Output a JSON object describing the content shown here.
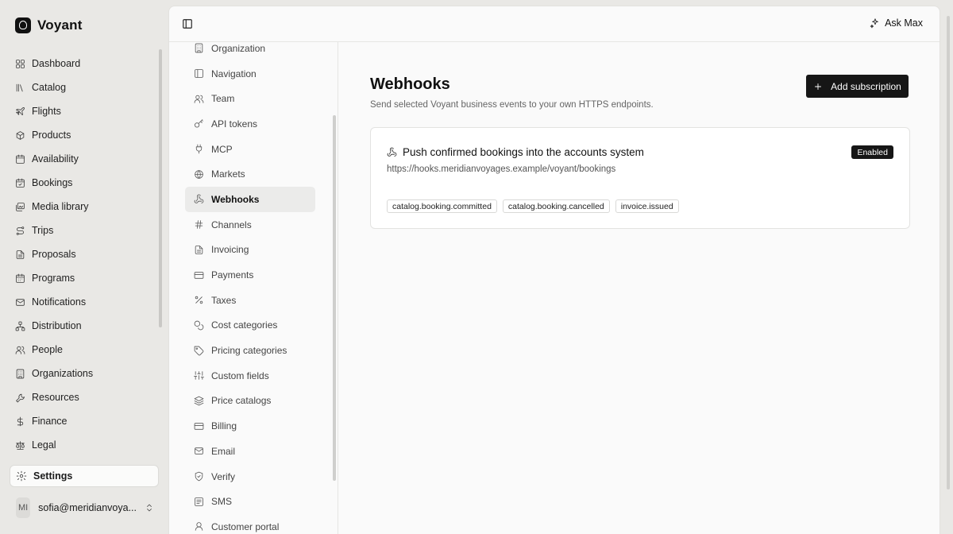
{
  "brand": {
    "name": "Voyant",
    "logo_icon": "voyant-logo"
  },
  "app_nav": [
    {
      "label": "Dashboard",
      "icon": "grid-icon"
    },
    {
      "label": "Catalog",
      "icon": "library-icon"
    },
    {
      "label": "Flights",
      "icon": "plane-icon"
    },
    {
      "label": "Products",
      "icon": "package-icon"
    },
    {
      "label": "Availability",
      "icon": "calendar-icon"
    },
    {
      "label": "Bookings",
      "icon": "calendar-check-icon"
    },
    {
      "label": "Media library",
      "icon": "images-icon"
    },
    {
      "label": "Trips",
      "icon": "route-icon"
    },
    {
      "label": "Proposals",
      "icon": "file-text-icon"
    },
    {
      "label": "Programs",
      "icon": "calendar-days-icon"
    },
    {
      "label": "Notifications",
      "icon": "mail-icon"
    },
    {
      "label": "Distribution",
      "icon": "network-icon"
    },
    {
      "label": "People",
      "icon": "users-icon"
    },
    {
      "label": "Organizations",
      "icon": "building-icon"
    },
    {
      "label": "Resources",
      "icon": "wrench-icon"
    },
    {
      "label": "Finance",
      "icon": "dollar-icon"
    },
    {
      "label": "Legal",
      "icon": "scale-icon"
    }
  ],
  "settings_item": {
    "label": "Settings",
    "icon": "gear-icon"
  },
  "user": {
    "initials": "MI",
    "email": "sofia@meridianvoya..."
  },
  "topbar": {
    "ask_label": "Ask Max"
  },
  "settings_nav": [
    {
      "label": "Organization",
      "icon": "building-icon"
    },
    {
      "label": "Navigation",
      "icon": "panel-left-icon"
    },
    {
      "label": "Team",
      "icon": "users-icon"
    },
    {
      "label": "API tokens",
      "icon": "key-icon"
    },
    {
      "label": "MCP",
      "icon": "plug-icon"
    },
    {
      "label": "Markets",
      "icon": "globe-icon"
    },
    {
      "label": "Webhooks",
      "icon": "webhook-icon",
      "active": true
    },
    {
      "label": "Channels",
      "icon": "hash-icon"
    },
    {
      "label": "Invoicing",
      "icon": "file-text-icon"
    },
    {
      "label": "Payments",
      "icon": "credit-card-icon"
    },
    {
      "label": "Taxes",
      "icon": "percent-icon"
    },
    {
      "label": "Cost categories",
      "icon": "coins-icon"
    },
    {
      "label": "Pricing categories",
      "icon": "tag-icon"
    },
    {
      "label": "Custom fields",
      "icon": "sliders-icon"
    },
    {
      "label": "Price catalogs",
      "icon": "layers-icon"
    },
    {
      "label": "Billing",
      "icon": "credit-card-icon"
    },
    {
      "label": "Email",
      "icon": "mail-icon"
    },
    {
      "label": "Verify",
      "icon": "shield-check-icon"
    },
    {
      "label": "SMS",
      "icon": "message-square-icon"
    },
    {
      "label": "Customer portal",
      "icon": "user-icon"
    }
  ],
  "page": {
    "title": "Webhooks",
    "subtitle": "Send selected Voyant business events to your own HTTPS endpoints.",
    "add_button_label": "Add subscription"
  },
  "subscription": {
    "title": "Push confirmed bookings into the accounts system",
    "url": "https://hooks.meridianvoyages.example/voyant/bookings",
    "status": "Enabled",
    "events": [
      "catalog.booking.committed",
      "catalog.booking.cancelled",
      "invoice.issued"
    ]
  }
}
